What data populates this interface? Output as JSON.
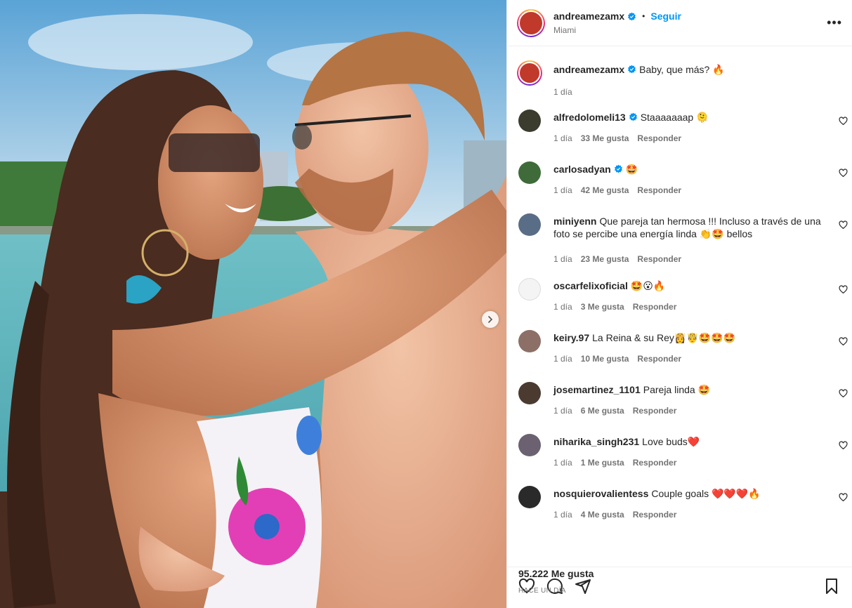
{
  "post": {
    "author": "andreamezamx",
    "follow_label": "Seguir",
    "dot": "•",
    "location": "Miami",
    "more_label": "•••",
    "caption_user": "andreamezamx",
    "caption_text": "Baby, que más? 🔥",
    "caption_time": "1 día"
  },
  "comments": [
    {
      "user": "alfredolomeli13",
      "verified": true,
      "text": "Staaaaaaap 🫠",
      "time": "1 día",
      "likes": "33 Me gusta",
      "reply": "Responder",
      "avatar_color": "#3b3b2e"
    },
    {
      "user": "carlosadyan",
      "verified": true,
      "text": "🤩",
      "time": "1 día",
      "likes": "42 Me gusta",
      "reply": "Responder",
      "avatar_color": "#3f6b3a"
    },
    {
      "user": "miniyenn",
      "verified": false,
      "text": "Que pareja tan hermosa !!! Incluso a través de una foto se percibe una energía linda 👏🤩 bellos",
      "time": "1 día",
      "likes": "23 Me gusta",
      "reply": "Responder",
      "avatar_color": "#5a6d86"
    },
    {
      "user": "oscarfelixoficial",
      "verified": false,
      "text": "🤩😮🔥",
      "time": "1 día",
      "likes": "3 Me gusta",
      "reply": "Responder",
      "avatar_color": "#f4f4f4"
    },
    {
      "user": "keiry.97",
      "verified": false,
      "text": "La Reina & su Rey👸🤴🤩🤩🤩",
      "time": "1 día",
      "likes": "10 Me gusta",
      "reply": "Responder",
      "avatar_color": "#8c6f66"
    },
    {
      "user": "josemartinez_1101",
      "verified": false,
      "text": "Pareja linda 🤩",
      "time": "1 día",
      "likes": "6 Me gusta",
      "reply": "Responder",
      "avatar_color": "#4a3a30"
    },
    {
      "user": "niharika_singh231",
      "verified": false,
      "text": "Love buds❤️",
      "time": "1 día",
      "likes": "1 Me gusta",
      "reply": "Responder",
      "avatar_color": "#6b6170"
    },
    {
      "user": "nosquierovalientess",
      "verified": false,
      "text": "Couple goals ❤️❤️❤️🔥",
      "time": "1 día",
      "likes": "4 Me gusta",
      "reply": "Responder",
      "avatar_color": "#2a2a2a"
    }
  ],
  "footer": {
    "likes": "95.222 Me gusta",
    "date": "HACE UN DÍA"
  },
  "colors": {
    "accent": "#0095f6",
    "verified": "#0095f6",
    "secondary_text": "#737373"
  },
  "icons": [
    "verified-badge-icon",
    "more-options-icon",
    "heart-icon",
    "comment-icon",
    "share-icon",
    "save-icon",
    "chevron-right-icon"
  ]
}
